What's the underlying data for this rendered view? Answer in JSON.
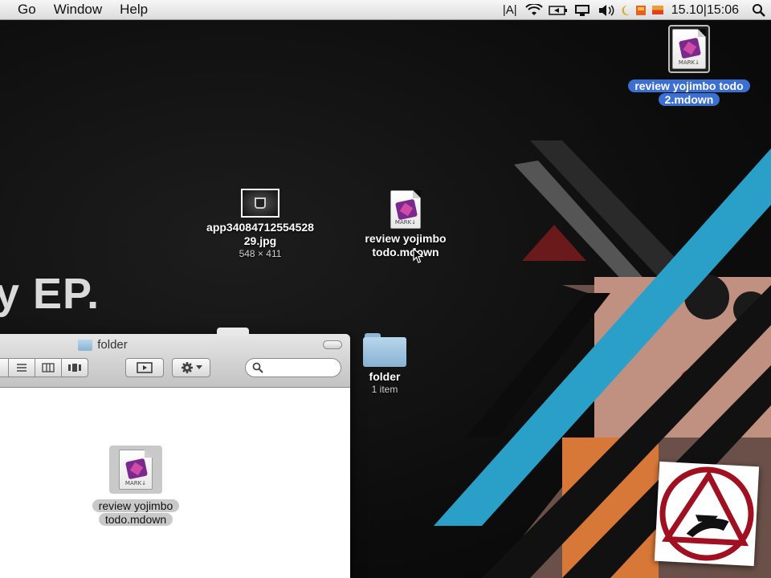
{
  "menubar": {
    "items": [
      "Go",
      "Window",
      "Help"
    ],
    "status": {
      "input_indicator": "|A|",
      "clock": "15.10|15:06"
    }
  },
  "desktop": {
    "wallpaper_text": "y EP.",
    "icons": [
      {
        "label": "review yojimbo todo 2.mdown",
        "line1": "review yojimbo todo",
        "line2": "2.mdown",
        "selected": true
      },
      {
        "label_line1": "app34084712554528",
        "label_line2": "29.jpg",
        "sub": "548 × 411"
      },
      {
        "label_line1": "review yojimbo",
        "label_line2": "todo.mdown"
      },
      {
        "label": "folder",
        "sub": "1 item"
      }
    ],
    "doc_badge": "MARK↓"
  },
  "finder": {
    "title": "folder",
    "item": {
      "line1": "review yojimbo",
      "line2": "todo.mdown"
    }
  },
  "colors": {
    "selection": "#3b6fd1",
    "accent_stripe": "#2aa0c8"
  }
}
